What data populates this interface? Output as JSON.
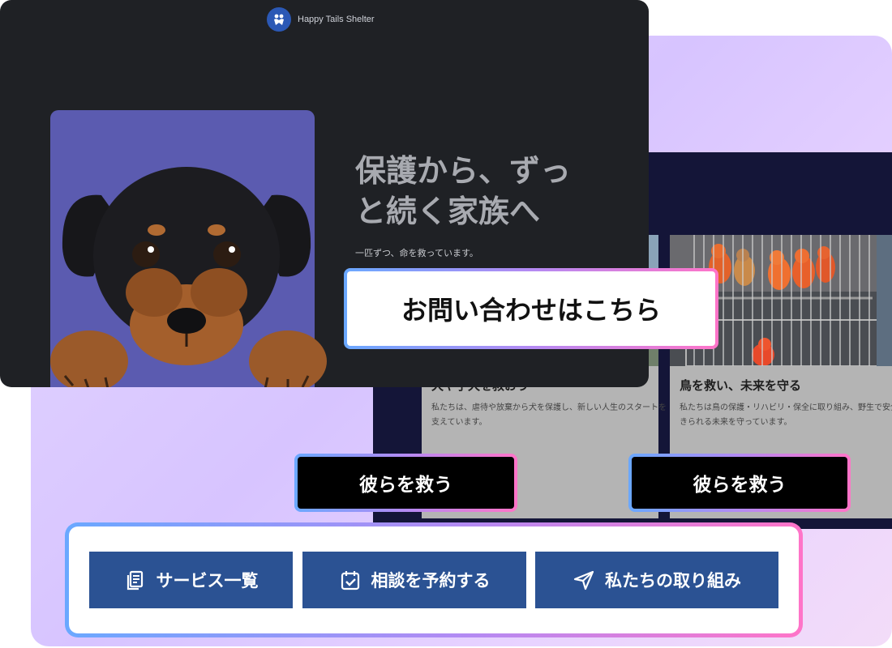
{
  "brand": {
    "name": "Happy Tails Shelter",
    "logo_icon": "paw-heart-icon"
  },
  "hero": {
    "headline": "保護から、ずっと続く家族へ",
    "tagline": "一匹ずつ、命を救っています。",
    "contact_button": "お問い合わせはこちら"
  },
  "cards": [
    {
      "title": "犬や子犬を救おう",
      "text": "私たちは、虐待や放棄から犬を保護し、新しい人生のスタートを支えています。",
      "button": "彼らを救う"
    },
    {
      "title": "鳥を救い、未来を守る",
      "text": "私たちは鳥の保護・リハビリ・保全に取り組み、野生で安全に生きられる未来を守っています。",
      "button": "彼らを救う"
    }
  ],
  "actions": [
    {
      "label": "サービス一覧",
      "icon": "list-document-icon"
    },
    {
      "label": "相談を予約する",
      "icon": "calendar-check-icon"
    },
    {
      "label": "私たちの取り組み",
      "icon": "send-icon"
    }
  ],
  "colors": {
    "hero_bg": "#1f2125",
    "dog_bg": "#5b5bb0",
    "action_blue": "#2b5293",
    "gradient_start": "#6aa8ff",
    "gradient_end": "#ff74c8",
    "backdrop": "#d7c4ff"
  }
}
